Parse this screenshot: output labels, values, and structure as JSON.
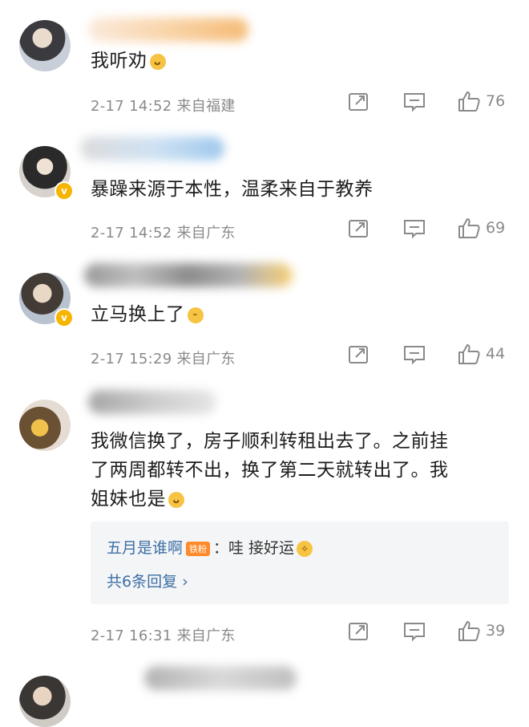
{
  "comments": [
    {
      "text": "我听劝",
      "emoji": "smirk-emoji",
      "time": "2-17 14:52",
      "location": "来自福建",
      "likes": "76",
      "verified": false
    },
    {
      "text": "暴躁来源于本性，温柔来自于教养",
      "time": "2-17 14:52",
      "location": "来自广东",
      "likes": "69",
      "verified": true
    },
    {
      "text": "立马换上了",
      "emoji": "grin-emoji",
      "time": "2-17 15:29",
      "location": "来自广东",
      "likes": "44",
      "verified": true
    },
    {
      "text_line1": "我微信换了，房子顺利转租出去了。之前挂",
      "text_line2": "了两周都转不出，换了第二天就转出了。我",
      "text_line3": "姐妹也是",
      "emoji": "smirk-emoji",
      "reply": {
        "name": "五月是谁啊",
        "badge": "铁粉",
        "text": "：哇 接好运",
        "more": "共6条回复 ›"
      },
      "time": "2-17 16:31",
      "location": "来自广东",
      "likes": "39",
      "verified": false
    }
  ],
  "colors": {
    "meta": "#8a8a8a",
    "link": "#3d6fa6",
    "badge": "#f7b500"
  },
  "icons": [
    "share-icon",
    "comment-icon",
    "like-icon"
  ]
}
